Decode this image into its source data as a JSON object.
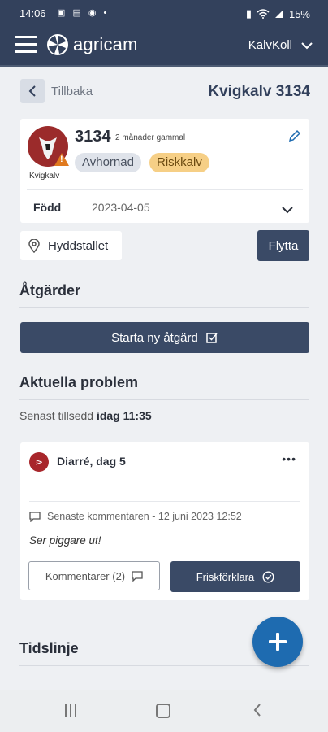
{
  "status_bar": {
    "time": "14:06",
    "battery": "15%"
  },
  "app_bar": {
    "logo_text": "agricam",
    "farm_name": "KalvKoll"
  },
  "page": {
    "back_label": "Tillbaka",
    "title": "Kvigkalv 3134"
  },
  "animal": {
    "id": "3134",
    "age": "2 månader gammal",
    "type_label": "Kvigkalv",
    "tags": [
      "Avhornad",
      "Riskkalv"
    ],
    "born_label": "Född",
    "born_date": "2023-04-05"
  },
  "location": {
    "name": "Hyddstallet",
    "move_label": "Flytta"
  },
  "actions": {
    "title": "Åtgärder",
    "start_label": "Starta ny åtgärd"
  },
  "problems": {
    "title": "Aktuella problem",
    "last_seen_prefix": "Senast tillsedd",
    "last_seen_value": "idag 11:35",
    "card": {
      "title": "Diarré, dag 5",
      "last_comment_meta": "Senaste kommentaren - 12 juni 2023 12:52",
      "last_comment": "Ser piggare ut!",
      "comments_label": "Kommentarer (2)",
      "heal_label": "Friskförklara"
    }
  },
  "timeline": {
    "title": "Tidslinje"
  },
  "colors": {
    "header": "#33415c",
    "button": "#3a4a66",
    "fab": "#1e6bb0",
    "risk_tag": "#f6cf86",
    "problem_icon": "#a8262b"
  }
}
